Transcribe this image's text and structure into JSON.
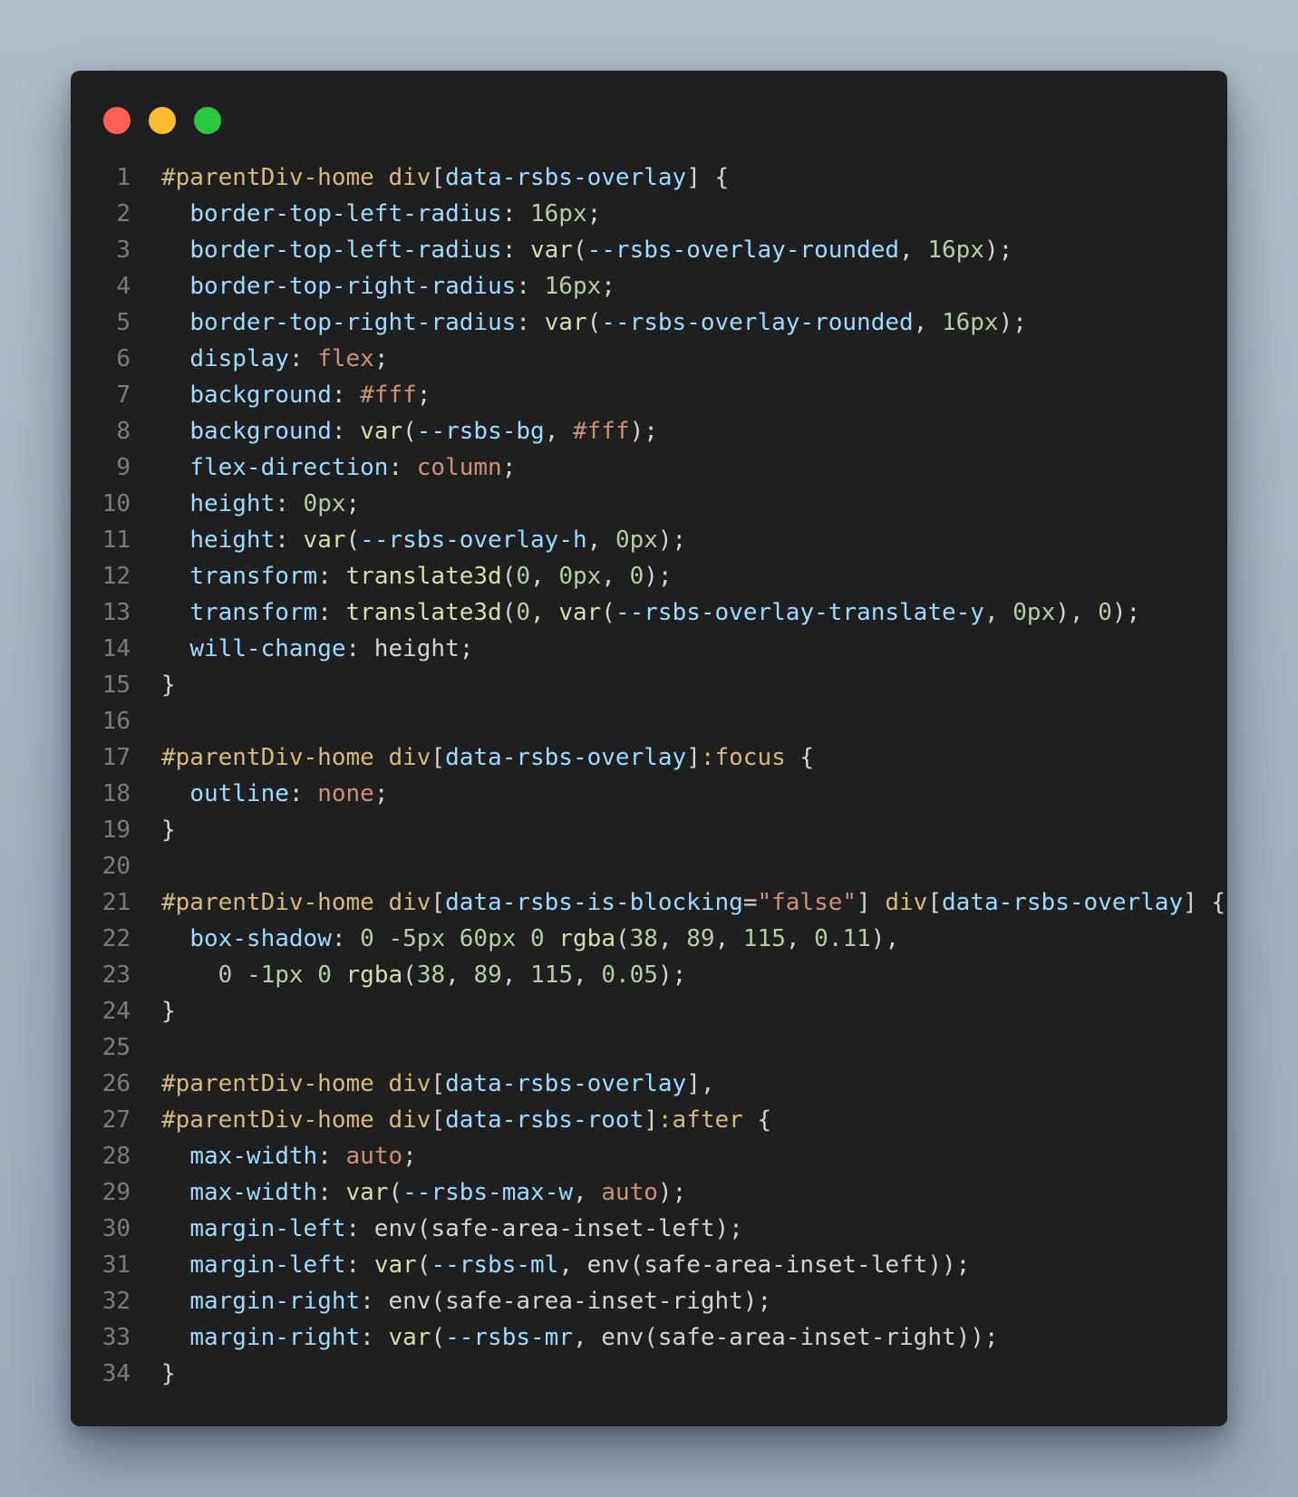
{
  "window": {
    "buttons": [
      {
        "name": "close",
        "color": "#ff5f57"
      },
      {
        "name": "minimize",
        "color": "#febc2e"
      },
      {
        "name": "maximize",
        "color": "#28c840"
      }
    ]
  },
  "editor": {
    "lines": [
      {
        "n": "1",
        "tokens": [
          [
            "sel",
            "#parentDiv-home div"
          ],
          [
            "plain",
            "["
          ],
          [
            "attr",
            "data-rsbs-overlay"
          ],
          [
            "plain",
            "] {"
          ]
        ]
      },
      {
        "n": "2",
        "tokens": [
          [
            "plain",
            "  "
          ],
          [
            "prop",
            "border-top-left-radius"
          ],
          [
            "plain",
            ": "
          ],
          [
            "num",
            "16px"
          ],
          [
            "plain",
            ";"
          ]
        ]
      },
      {
        "n": "3",
        "tokens": [
          [
            "plain",
            "  "
          ],
          [
            "prop",
            "border-top-left-radius"
          ],
          [
            "plain",
            ": "
          ],
          [
            "fn",
            "var"
          ],
          [
            "plain",
            "("
          ],
          [
            "attr",
            "--rsbs-overlay-rounded"
          ],
          [
            "plain",
            ", "
          ],
          [
            "num",
            "16px"
          ],
          [
            "plain",
            ");"
          ]
        ]
      },
      {
        "n": "4",
        "tokens": [
          [
            "plain",
            "  "
          ],
          [
            "prop",
            "border-top-right-radius"
          ],
          [
            "plain",
            ": "
          ],
          [
            "num",
            "16px"
          ],
          [
            "plain",
            ";"
          ]
        ]
      },
      {
        "n": "5",
        "tokens": [
          [
            "plain",
            "  "
          ],
          [
            "prop",
            "border-top-right-radius"
          ],
          [
            "plain",
            ": "
          ],
          [
            "fn",
            "var"
          ],
          [
            "plain",
            "("
          ],
          [
            "attr",
            "--rsbs-overlay-rounded"
          ],
          [
            "plain",
            ", "
          ],
          [
            "num",
            "16px"
          ],
          [
            "plain",
            ");"
          ]
        ]
      },
      {
        "n": "6",
        "tokens": [
          [
            "plain",
            "  "
          ],
          [
            "prop",
            "display"
          ],
          [
            "plain",
            ": "
          ],
          [
            "kw",
            "flex"
          ],
          [
            "plain",
            ";"
          ]
        ]
      },
      {
        "n": "7",
        "tokens": [
          [
            "plain",
            "  "
          ],
          [
            "prop",
            "background"
          ],
          [
            "plain",
            ": "
          ],
          [
            "kw",
            "#fff"
          ],
          [
            "plain",
            ";"
          ]
        ]
      },
      {
        "n": "8",
        "tokens": [
          [
            "plain",
            "  "
          ],
          [
            "prop",
            "background"
          ],
          [
            "plain",
            ": "
          ],
          [
            "fn",
            "var"
          ],
          [
            "plain",
            "("
          ],
          [
            "attr",
            "--rsbs-bg"
          ],
          [
            "plain",
            ", "
          ],
          [
            "kw",
            "#fff"
          ],
          [
            "plain",
            ");"
          ]
        ]
      },
      {
        "n": "9",
        "tokens": [
          [
            "plain",
            "  "
          ],
          [
            "prop",
            "flex-direction"
          ],
          [
            "plain",
            ": "
          ],
          [
            "kw",
            "column"
          ],
          [
            "plain",
            ";"
          ]
        ]
      },
      {
        "n": "10",
        "tokens": [
          [
            "plain",
            "  "
          ],
          [
            "prop",
            "height"
          ],
          [
            "plain",
            ": "
          ],
          [
            "num",
            "0px"
          ],
          [
            "plain",
            ";"
          ]
        ]
      },
      {
        "n": "11",
        "tokens": [
          [
            "plain",
            "  "
          ],
          [
            "prop",
            "height"
          ],
          [
            "plain",
            ": "
          ],
          [
            "fn",
            "var"
          ],
          [
            "plain",
            "("
          ],
          [
            "attr",
            "--rsbs-overlay-h"
          ],
          [
            "plain",
            ", "
          ],
          [
            "num",
            "0px"
          ],
          [
            "plain",
            ");"
          ]
        ]
      },
      {
        "n": "12",
        "tokens": [
          [
            "plain",
            "  "
          ],
          [
            "prop",
            "transform"
          ],
          [
            "plain",
            ": "
          ],
          [
            "fn",
            "translate3d"
          ],
          [
            "plain",
            "("
          ],
          [
            "num",
            "0"
          ],
          [
            "plain",
            ", "
          ],
          [
            "num",
            "0px"
          ],
          [
            "plain",
            ", "
          ],
          [
            "num",
            "0"
          ],
          [
            "plain",
            ");"
          ]
        ]
      },
      {
        "n": "13",
        "tokens": [
          [
            "plain",
            "  "
          ],
          [
            "prop",
            "transform"
          ],
          [
            "plain",
            ": "
          ],
          [
            "fn",
            "translate3d"
          ],
          [
            "plain",
            "("
          ],
          [
            "num",
            "0"
          ],
          [
            "plain",
            ", "
          ],
          [
            "fn",
            "var"
          ],
          [
            "plain",
            "("
          ],
          [
            "attr",
            "--rsbs-overlay-translate-y"
          ],
          [
            "plain",
            ", "
          ],
          [
            "num",
            "0px"
          ],
          [
            "plain",
            "), "
          ],
          [
            "num",
            "0"
          ],
          [
            "plain",
            ");"
          ]
        ]
      },
      {
        "n": "14",
        "tokens": [
          [
            "plain",
            "  "
          ],
          [
            "prop",
            "will-change"
          ],
          [
            "plain",
            ": height;"
          ]
        ]
      },
      {
        "n": "15",
        "tokens": [
          [
            "plain",
            "}"
          ]
        ]
      },
      {
        "n": "16",
        "tokens": []
      },
      {
        "n": "17",
        "tokens": [
          [
            "sel",
            "#parentDiv-home div"
          ],
          [
            "plain",
            "["
          ],
          [
            "attr",
            "data-rsbs-overlay"
          ],
          [
            "plain",
            "]"
          ],
          [
            "sel",
            ":focus"
          ],
          [
            "plain",
            " {"
          ]
        ]
      },
      {
        "n": "18",
        "tokens": [
          [
            "plain",
            "  "
          ],
          [
            "prop",
            "outline"
          ],
          [
            "plain",
            ": "
          ],
          [
            "kw",
            "none"
          ],
          [
            "plain",
            ";"
          ]
        ]
      },
      {
        "n": "19",
        "tokens": [
          [
            "plain",
            "}"
          ]
        ]
      },
      {
        "n": "20",
        "tokens": []
      },
      {
        "n": "21",
        "tokens": [
          [
            "sel",
            "#parentDiv-home div"
          ],
          [
            "plain",
            "["
          ],
          [
            "attr",
            "data-rsbs-is-blocking"
          ],
          [
            "plain",
            "="
          ],
          [
            "str",
            "\"false\""
          ],
          [
            "plain",
            "] "
          ],
          [
            "sel",
            "div"
          ],
          [
            "plain",
            "["
          ],
          [
            "attr",
            "data-rsbs-overlay"
          ],
          [
            "plain",
            "] {"
          ]
        ]
      },
      {
        "n": "22",
        "tokens": [
          [
            "plain",
            "  "
          ],
          [
            "prop",
            "box-shadow"
          ],
          [
            "plain",
            ": "
          ],
          [
            "num",
            "0"
          ],
          [
            "plain",
            " "
          ],
          [
            "num",
            "-5px"
          ],
          [
            "plain",
            " "
          ],
          [
            "num",
            "60px"
          ],
          [
            "plain",
            " "
          ],
          [
            "num",
            "0"
          ],
          [
            "plain",
            " "
          ],
          [
            "fn",
            "rgba"
          ],
          [
            "plain",
            "("
          ],
          [
            "num",
            "38"
          ],
          [
            "plain",
            ", "
          ],
          [
            "num",
            "89"
          ],
          [
            "plain",
            ", "
          ],
          [
            "num",
            "115"
          ],
          [
            "plain",
            ", "
          ],
          [
            "num",
            "0.11"
          ],
          [
            "plain",
            "),"
          ]
        ]
      },
      {
        "n": "23",
        "tokens": [
          [
            "plain",
            "    "
          ],
          [
            "num",
            "0"
          ],
          [
            "plain",
            " "
          ],
          [
            "num",
            "-1px"
          ],
          [
            "plain",
            " "
          ],
          [
            "num",
            "0"
          ],
          [
            "plain",
            " "
          ],
          [
            "fn",
            "rgba"
          ],
          [
            "plain",
            "("
          ],
          [
            "num",
            "38"
          ],
          [
            "plain",
            ", "
          ],
          [
            "num",
            "89"
          ],
          [
            "plain",
            ", "
          ],
          [
            "num",
            "115"
          ],
          [
            "plain",
            ", "
          ],
          [
            "num",
            "0.05"
          ],
          [
            "plain",
            ");"
          ]
        ]
      },
      {
        "n": "24",
        "tokens": [
          [
            "plain",
            "}"
          ]
        ]
      },
      {
        "n": "25",
        "tokens": []
      },
      {
        "n": "26",
        "tokens": [
          [
            "sel",
            "#parentDiv-home div"
          ],
          [
            "plain",
            "["
          ],
          [
            "attr",
            "data-rsbs-overlay"
          ],
          [
            "plain",
            "],"
          ]
        ]
      },
      {
        "n": "27",
        "tokens": [
          [
            "sel",
            "#parentDiv-home div"
          ],
          [
            "plain",
            "["
          ],
          [
            "attr",
            "data-rsbs-root"
          ],
          [
            "plain",
            "]"
          ],
          [
            "sel",
            ":after"
          ],
          [
            "plain",
            " {"
          ]
        ]
      },
      {
        "n": "28",
        "tokens": [
          [
            "plain",
            "  "
          ],
          [
            "prop",
            "max-width"
          ],
          [
            "plain",
            ": "
          ],
          [
            "kw",
            "auto"
          ],
          [
            "plain",
            ";"
          ]
        ]
      },
      {
        "n": "29",
        "tokens": [
          [
            "plain",
            "  "
          ],
          [
            "prop",
            "max-width"
          ],
          [
            "plain",
            ": "
          ],
          [
            "fn",
            "var"
          ],
          [
            "plain",
            "("
          ],
          [
            "attr",
            "--rsbs-max-w"
          ],
          [
            "plain",
            ", "
          ],
          [
            "kw",
            "auto"
          ],
          [
            "plain",
            ");"
          ]
        ]
      },
      {
        "n": "30",
        "tokens": [
          [
            "plain",
            "  "
          ],
          [
            "prop",
            "margin-left"
          ],
          [
            "plain",
            ": env(safe-area-inset-left);"
          ]
        ]
      },
      {
        "n": "31",
        "tokens": [
          [
            "plain",
            "  "
          ],
          [
            "prop",
            "margin-left"
          ],
          [
            "plain",
            ": "
          ],
          [
            "fn",
            "var"
          ],
          [
            "plain",
            "("
          ],
          [
            "attr",
            "--rsbs-ml"
          ],
          [
            "plain",
            ", env(safe-area-inset-left));"
          ]
        ]
      },
      {
        "n": "32",
        "tokens": [
          [
            "plain",
            "  "
          ],
          [
            "prop",
            "margin-right"
          ],
          [
            "plain",
            ": env(safe-area-inset-right);"
          ]
        ]
      },
      {
        "n": "33",
        "tokens": [
          [
            "plain",
            "  "
          ],
          [
            "prop",
            "margin-right"
          ],
          [
            "plain",
            ": "
          ],
          [
            "fn",
            "var"
          ],
          [
            "plain",
            "("
          ],
          [
            "attr",
            "--rsbs-mr"
          ],
          [
            "plain",
            ", env(safe-area-inset-right));"
          ]
        ]
      },
      {
        "n": "34",
        "tokens": [
          [
            "plain",
            "}"
          ]
        ]
      }
    ]
  }
}
